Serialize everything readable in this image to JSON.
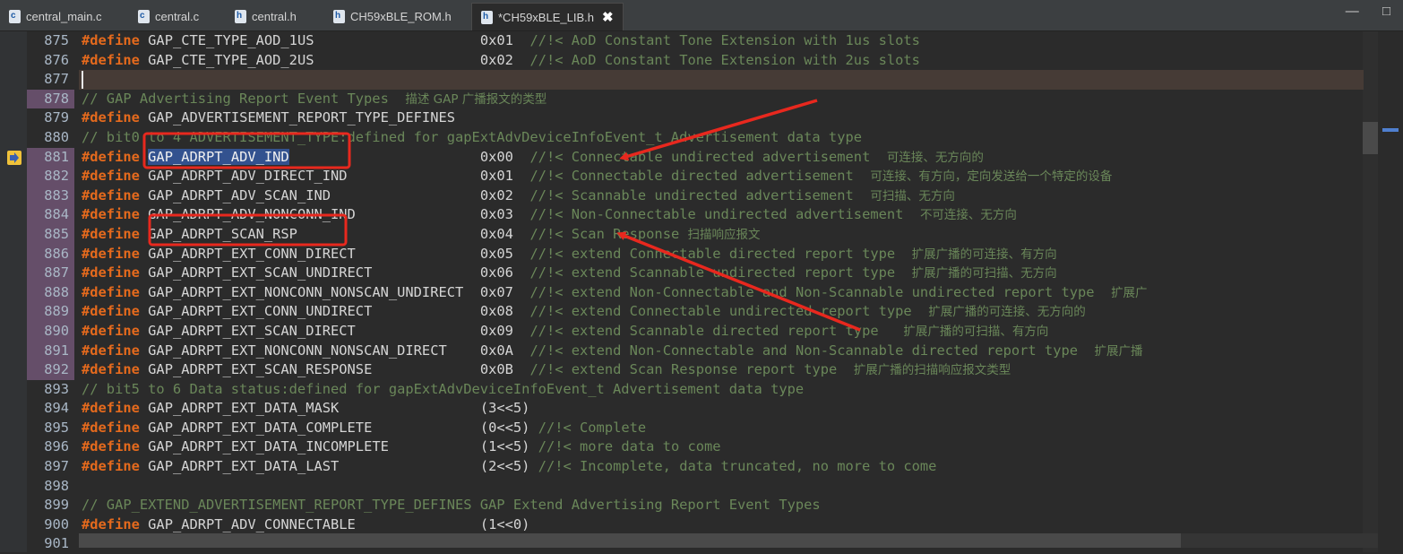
{
  "tabs": [
    {
      "icon": "c",
      "label": "central_main.c"
    },
    {
      "icon": "c",
      "label": "central.c"
    },
    {
      "icon": "h",
      "label": "central.h"
    },
    {
      "icon": "h",
      "label": "CH59xBLE_ROM.h"
    },
    {
      "icon": "h",
      "label": "*CH59xBLE_LIB.h",
      "active": true
    }
  ],
  "window_controls": {
    "minimize": "—",
    "maximize": "□"
  },
  "colors": {
    "keyword": "#e56a1d",
    "comment": "#6a8759",
    "selection": "#33528f",
    "modified_line": "#654e69",
    "annotation": "#e8281e"
  },
  "lines": [
    {
      "n": "875",
      "kw": "#define",
      "name": "GAP_CTE_TYPE_AOD_1US",
      "pad": "                    ",
      "value": "0x01",
      "comment": "//!< AoD Constant Tone Extension with 1us slots",
      "cn": ""
    },
    {
      "n": "876",
      "kw": "#define",
      "name": "GAP_CTE_TYPE_AOD_2US",
      "pad": "                    ",
      "value": "0x02",
      "comment": "//!< AoD Constant Tone Extension with 2us slots",
      "cn": ""
    },
    {
      "n": "877",
      "kw": "",
      "name": "",
      "pad": "",
      "value": "",
      "comment": "",
      "cn": "",
      "current": true
    },
    {
      "n": "878",
      "kw": "",
      "name": "",
      "pad": "",
      "value": "",
      "comment": "// GAP Advertising Report Event Types  ",
      "cn": "描述 GAP 广播报文的类型",
      "mod": true
    },
    {
      "n": "879",
      "kw": "#define",
      "name": "GAP_ADVERTISEMENT_REPORT_TYPE_DEFINES",
      "pad": "",
      "value": "",
      "comment": "",
      "cn": ""
    },
    {
      "n": "880",
      "kw": "",
      "name": "",
      "pad": "",
      "value": "",
      "comment": "// bit0 to 4 ADVERTISEMENT_TYPE:defined for gapExtAdvDeviceInfoEvent_t Advertisement data type",
      "cn": ""
    },
    {
      "n": "881",
      "kw": "#define",
      "name": "GAP_ADRPT_ADV_IND",
      "pad": "                       ",
      "value": "0x00",
      "comment": "//!< Connectable undirected advertisement  ",
      "cn": "可连接、无方向的",
      "mod": true,
      "selected": true,
      "marker": true
    },
    {
      "n": "882",
      "kw": "#define",
      "name": "GAP_ADRPT_ADV_DIRECT_IND",
      "pad": "                ",
      "value": "0x01",
      "comment": "//!< Connectable directed advertisement  ",
      "cn": "可连接、有方向，定向发送给一个特定的设备",
      "mod": true
    },
    {
      "n": "883",
      "kw": "#define",
      "name": "GAP_ADRPT_ADV_SCAN_IND",
      "pad": "                  ",
      "value": "0x02",
      "comment": "//!< Scannable undirected advertisement  ",
      "cn": "可扫描、无方向",
      "mod": true
    },
    {
      "n": "884",
      "kw": "#define",
      "name": "GAP_ADRPT_ADV_NONCONN_IND",
      "pad": "               ",
      "value": "0x03",
      "comment": "//!< Non-Connectable undirected advertisement  ",
      "cn": "不可连接、无方向",
      "mod": true
    },
    {
      "n": "885",
      "kw": "#define",
      "name": "GAP_ADRPT_SCAN_RSP",
      "pad": "                      ",
      "value": "0x04",
      "comment": "//!< Scan Response ",
      "cn": "扫描响应报文",
      "mod": true
    },
    {
      "n": "886",
      "kw": "#define",
      "name": "GAP_ADRPT_EXT_CONN_DIRECT",
      "pad": "               ",
      "value": "0x05",
      "comment": "//!< extend Connectable directed report type  ",
      "cn": "扩展广播的可连接、有方向",
      "mod": true
    },
    {
      "n": "887",
      "kw": "#define",
      "name": "GAP_ADRPT_EXT_SCAN_UNDIRECT",
      "pad": "             ",
      "value": "0x06",
      "comment": "//!< extend Scannable undirected report type  ",
      "cn": "扩展广播的可扫描、无方向",
      "mod": true
    },
    {
      "n": "888",
      "kw": "#define",
      "name": "GAP_ADRPT_EXT_NONCONN_NONSCAN_UNDIRECT",
      "pad": "  ",
      "value": "0x07",
      "comment": "//!< extend Non-Connectable and Non-Scannable undirected report type  ",
      "cn": "扩展广",
      "mod": true
    },
    {
      "n": "889",
      "kw": "#define",
      "name": "GAP_ADRPT_EXT_CONN_UNDIRECT",
      "pad": "             ",
      "value": "0x08",
      "comment": "//!< extend Connectable undirected report type  ",
      "cn": "扩展广播的可连接、无方向的",
      "mod": true
    },
    {
      "n": "890",
      "kw": "#define",
      "name": "GAP_ADRPT_EXT_SCAN_DIRECT",
      "pad": "               ",
      "value": "0x09",
      "comment": "//!< extend Scannable directed report type   ",
      "cn": "扩展广播的可扫描、有方向",
      "mod": true
    },
    {
      "n": "891",
      "kw": "#define",
      "name": "GAP_ADRPT_EXT_NONCONN_NONSCAN_DIRECT",
      "pad": "    ",
      "value": "0x0A",
      "comment": "//!< extend Non-Connectable and Non-Scannable directed report type  ",
      "cn": "扩展广播",
      "mod": true
    },
    {
      "n": "892",
      "kw": "#define",
      "name": "GAP_ADRPT_EXT_SCAN_RESPONSE",
      "pad": "             ",
      "value": "0x0B",
      "comment": "//!< extend Scan Response report type  ",
      "cn": "扩展广播的扫描响应报文类型",
      "mod": true
    },
    {
      "n": "893",
      "kw": "",
      "name": "",
      "pad": "",
      "value": "",
      "comment": "// bit5 to 6 Data status:defined for gapExtAdvDeviceInfoEvent_t Advertisement data type",
      "cn": ""
    },
    {
      "n": "894",
      "kw": "#define",
      "name": "GAP_ADRPT_EXT_DATA_MASK",
      "pad": "                 ",
      "value": "(3<<5)",
      "comment": "",
      "cn": ""
    },
    {
      "n": "895",
      "kw": "#define",
      "name": "GAP_ADRPT_EXT_DATA_COMPLETE",
      "pad": "             ",
      "value": "(0<<5)",
      "comment": " //!< Complete",
      "cn": ""
    },
    {
      "n": "896",
      "kw": "#define",
      "name": "GAP_ADRPT_EXT_DATA_INCOMPLETE",
      "pad": "           ",
      "value": "(1<<5)",
      "comment": " //!< more data to come",
      "cn": ""
    },
    {
      "n": "897",
      "kw": "#define",
      "name": "GAP_ADRPT_EXT_DATA_LAST",
      "pad": "                 ",
      "value": "(2<<5)",
      "comment": " //!< Incomplete, data truncated, no more to come",
      "cn": ""
    },
    {
      "n": "898",
      "kw": "",
      "name": "",
      "pad": "",
      "value": "",
      "comment": "",
      "cn": ""
    },
    {
      "n": "899",
      "kw": "",
      "name": "",
      "pad": "",
      "value": "",
      "comment": "// GAP_EXTEND_ADVERTISEMENT_REPORT_TYPE_DEFINES GAP Extend Advertising Report Event Types",
      "cn": ""
    },
    {
      "n": "900",
      "kw": "#define",
      "name": "GAP_ADRPT_ADV_CONNECTABLE",
      "pad": "               ",
      "value": "(1<<0)",
      "comment": "",
      "cn": ""
    },
    {
      "n": "901",
      "kw": "",
      "name": "",
      "pad": "",
      "value": "",
      "comment": "",
      "cn": ""
    }
  ]
}
